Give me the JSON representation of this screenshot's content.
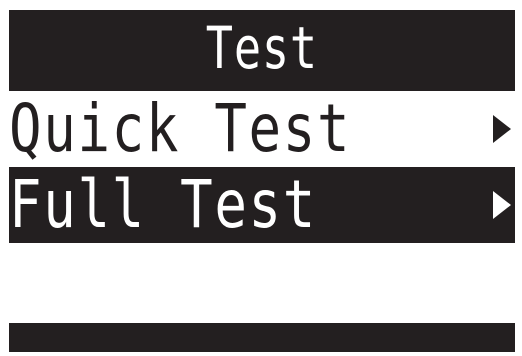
{
  "screen": {
    "title": "Test",
    "menu": [
      {
        "label": "Quick Test",
        "selected": true,
        "has_submenu": true
      },
      {
        "label": "Full Test",
        "selected": false,
        "has_submenu": true
      }
    ]
  },
  "colors": {
    "display_dark": "#231f20",
    "display_light": "#ffffff"
  },
  "icons": {
    "submenu_arrow": "right-triangle"
  }
}
